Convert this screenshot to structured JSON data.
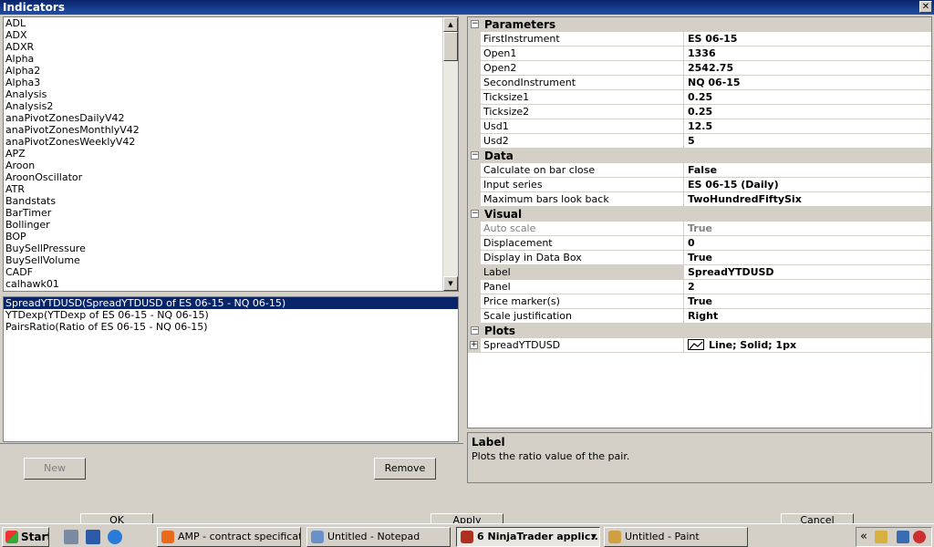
{
  "window": {
    "title": "Indicators",
    "close_label": "✕"
  },
  "indicator_list": [
    "ADL",
    "ADX",
    "ADXR",
    "Alpha",
    "Alpha2",
    "Alpha3",
    "Analysis",
    "Analysis2",
    "anaPivotZonesDailyV42",
    "anaPivotZonesMonthlyV42",
    "anaPivotZonesWeeklyV42",
    "APZ",
    "Aroon",
    "AroonOscillator",
    "ATR",
    "Bandstats",
    "BarTimer",
    "Bollinger",
    "BOP",
    "BuySellPressure",
    "BuySellVolume",
    "CADF",
    "calhawk01"
  ],
  "applied_indicators": [
    {
      "label": "SpreadYTDUSD(SpreadYTDUSD of ES 06-15 - NQ 06-15)",
      "selected": true
    },
    {
      "label": "YTDexp(YTDexp of ES 06-15 - NQ 06-15)",
      "selected": false
    },
    {
      "label": "PairsRatio(Ratio of ES 06-15 - NQ 06-15)",
      "selected": false
    }
  ],
  "buttons": {
    "new": "New",
    "remove": "Remove",
    "ok": "OK",
    "apply": "Apply",
    "cancel": "Cancel"
  },
  "properties": {
    "parameters": {
      "title": "Parameters",
      "rows": [
        {
          "name": "FirstInstrument",
          "value": "ES 06-15"
        },
        {
          "name": "Open1",
          "value": "1336"
        },
        {
          "name": "Open2",
          "value": "2542.75"
        },
        {
          "name": "SecondInstrument",
          "value": "NQ 06-15"
        },
        {
          "name": "Ticksize1",
          "value": "0.25"
        },
        {
          "name": "Ticksize2",
          "value": "0.25"
        },
        {
          "name": "Usd1",
          "value": "12.5"
        },
        {
          "name": "Usd2",
          "value": "5"
        }
      ]
    },
    "data": {
      "title": "Data",
      "rows": [
        {
          "name": "Calculate on bar close",
          "value": "False"
        },
        {
          "name": "Input series",
          "value": "ES 06-15 (Daily)"
        },
        {
          "name": "Maximum bars look back",
          "value": "TwoHundredFiftySix"
        }
      ]
    },
    "visual": {
      "title": "Visual",
      "rows": [
        {
          "name": "Auto scale",
          "value": "True",
          "disabled": true
        },
        {
          "name": "Displacement",
          "value": "0"
        },
        {
          "name": "Display in Data Box",
          "value": "True"
        },
        {
          "name": "Label",
          "value": "SpreadYTDUSD",
          "selected": true
        },
        {
          "name": "Panel",
          "value": "2"
        },
        {
          "name": "Price marker(s)",
          "value": "True"
        },
        {
          "name": "Scale justification",
          "value": "Right"
        }
      ]
    },
    "plots": {
      "title": "Plots",
      "rows": [
        {
          "name": "SpreadYTDUSD",
          "value": "Line; Solid; 1px"
        }
      ]
    }
  },
  "description": {
    "title": "Label",
    "text": "Plots the ratio value of the pair."
  },
  "taskbar": {
    "start": "Start",
    "items": [
      {
        "label": "AMP - contract specificat...",
        "active": false
      },
      {
        "label": "Untitled - Notepad",
        "active": false
      },
      {
        "label": "6 NinjaTrader applic...",
        "active": true
      },
      {
        "label": "Untitled - Paint",
        "active": false
      }
    ],
    "tray_chevron": "«"
  },
  "colors": {
    "titlebar": "#0a246a",
    "selection": "#0a246a",
    "face": "#d4d0c8"
  }
}
